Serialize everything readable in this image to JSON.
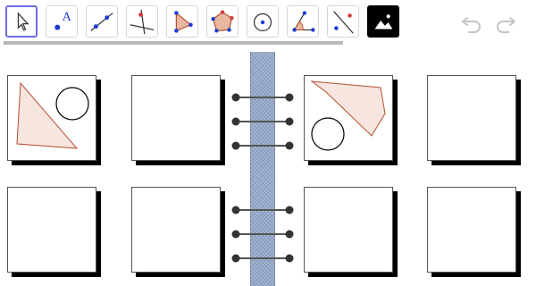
{
  "toolbar": {
    "tools": [
      {
        "name": "move-tool",
        "icon": "cursor-arrow-icon",
        "selected": true
      },
      {
        "name": "point-tool",
        "icon": "point-with-label-icon",
        "label": "A"
      },
      {
        "name": "line-tool",
        "icon": "line-through-two-points-icon"
      },
      {
        "name": "perpendicular-line-tool",
        "icon": "perpendicular-line-icon"
      },
      {
        "name": "polygon-tool",
        "icon": "polygon-icon"
      },
      {
        "name": "regular-polygon-tool",
        "icon": "pentagon-icon"
      },
      {
        "name": "circle-tool",
        "icon": "circle-with-center-icon"
      },
      {
        "name": "angle-tool",
        "icon": "angle-icon"
      },
      {
        "name": "reflect-tool",
        "icon": "reflect-about-line-icon"
      },
      {
        "name": "image-tool",
        "icon": "image-icon"
      }
    ],
    "undo_icon": "undo-arrow-icon",
    "redo_icon": "redo-arrow-icon"
  },
  "notebook": {
    "spine_icon": "notebook-spine",
    "rings": 6,
    "cards": [
      {
        "name": "card-top-left",
        "content": "triangle-and-circle"
      },
      {
        "name": "card-top-center-left",
        "content": "blank"
      },
      {
        "name": "card-top-center-right",
        "content": "pentagon-and-circle"
      },
      {
        "name": "card-top-right",
        "content": "blank"
      },
      {
        "name": "card-bottom-left",
        "content": "blank"
      },
      {
        "name": "card-bottom-center-left",
        "content": "blank"
      },
      {
        "name": "card-bottom-center-right",
        "content": "blank"
      },
      {
        "name": "card-bottom-right",
        "content": "blank"
      }
    ]
  },
  "colors": {
    "shape_stroke": "#b5502f",
    "shape_fill": "#f7e5df",
    "point_blue": "#1c3cd1",
    "point_red": "#d43a3a",
    "selected_border": "#6b6ee0",
    "spine_fill": "#a9b9d6"
  }
}
